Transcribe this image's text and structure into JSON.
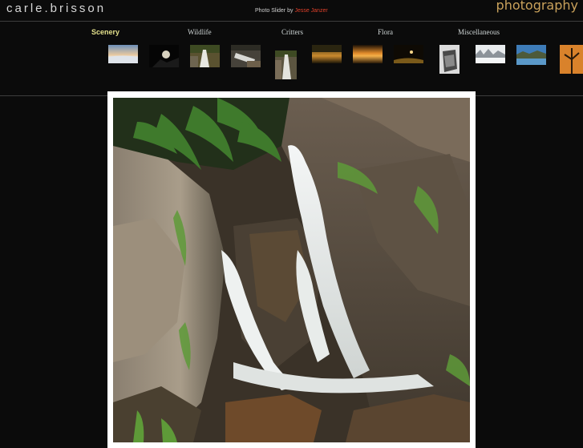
{
  "header": {
    "site_name": "carle.brisson",
    "credit_prefix": "Photo Slider by",
    "credit_author": "Jesse Janzer",
    "tagline": "photography"
  },
  "categories": [
    {
      "label": "Scenery",
      "active": true
    },
    {
      "label": "Wildlife",
      "active": false
    },
    {
      "label": "Critters",
      "active": false
    },
    {
      "label": "Flora",
      "active": false
    },
    {
      "label": "Miscellaneous",
      "active": false
    }
  ],
  "colors": {
    "background": "#0b0b0b",
    "active_category": "#e3e08b",
    "category": "#cfd6d6",
    "author_link": "#e0402a",
    "tagline": "#c9a15b"
  }
}
